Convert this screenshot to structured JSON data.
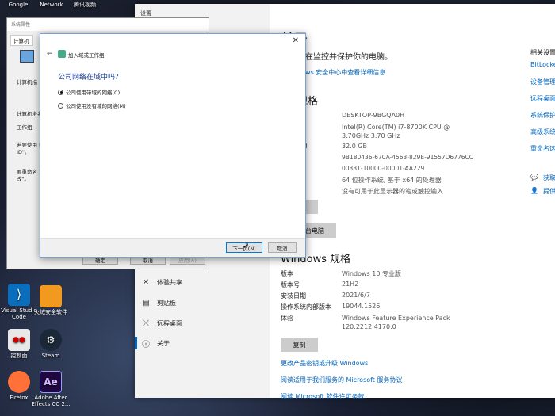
{
  "desktop": {
    "top_icons": [
      {
        "label": "Google"
      },
      {
        "label": "Network"
      },
      {
        "label": "腾讯视频"
      }
    ],
    "icons": [
      {
        "label": "Visual Studio Code",
        "icon": "vscode-icon",
        "color": "#0a6ebd"
      },
      {
        "label": "火绒安全软件",
        "icon": "huorong-icon",
        "color": "#f29a1f"
      },
      {
        "label": "控制面",
        "icon": "control-icon",
        "color": "#e8e8e8"
      },
      {
        "label": "Steam",
        "icon": "steam-icon",
        "color": "#1b2838"
      },
      {
        "label": "Firefox",
        "icon": "firefox-icon",
        "color": "#ff7139"
      },
      {
        "label": "Adobe After Effects CC 2...",
        "icon": "ae-icon",
        "color": "#1f0740",
        "badge": "Ae"
      }
    ]
  },
  "settings": {
    "window_title": "设置",
    "nav": [
      {
        "label": "体验共享",
        "icon": "share-icon"
      },
      {
        "label": "剪贴板",
        "icon": "clipboard-icon"
      },
      {
        "label": "远程桌面",
        "icon": "remote-icon"
      },
      {
        "label": "关于",
        "icon": "info-icon"
      }
    ],
    "page_title": "关于",
    "protect_text": "正在监控并保护你的电脑。",
    "security_link": "ndows 安全中心中查看详细信息",
    "device_spec_title": "规格",
    "device_specs": [
      {
        "label": "称",
        "value": "DESKTOP-9BGQA0H"
      },
      {
        "label": "",
        "value": "Intel(R) Core(TM) i7-8700K CPU @ 3.70GHz 3.70 GHz"
      },
      {
        "label": "AM",
        "value": "32.0 GB"
      },
      {
        "label": "",
        "value": "9B180436-670A-4563-829E-91557D6776CC"
      },
      {
        "label": "",
        "value": "00331-10000-00001-AA229"
      },
      {
        "label": "型",
        "value": "64 位操作系统, 基于 x64 的处理器"
      },
      {
        "label": "控",
        "value": "没有可用于此显示器的笔或触控输入"
      }
    ],
    "copy_btn_1": "制",
    "rename_btn": "名这台电脑",
    "win_spec_title": "Windows 规格",
    "win_specs": [
      {
        "label": "版本",
        "value": "Windows 10 专业版"
      },
      {
        "label": "版本号",
        "value": "21H2"
      },
      {
        "label": "安装日期",
        "value": "2021/6/7"
      },
      {
        "label": "操作系统内部版本",
        "value": "19044.1526"
      },
      {
        "label": "体验",
        "value": "Windows Feature Experience Pack 120.2212.4170.0"
      }
    ],
    "copy_btn_2": "复制",
    "links": [
      "更改产品密钥或升级 Windows",
      "阅读适用于我们服务的 Microsoft 服务协议",
      "阅读 Microsoft 软件许可条款"
    ],
    "related_title": "相关设置",
    "related_links": [
      "BitLocker",
      "设备管理",
      "远程桌面",
      "系统保护",
      "高级系统",
      "重命名这"
    ],
    "help": [
      {
        "label": "获取",
        "icon": "help-icon"
      },
      {
        "label": "提供",
        "icon": "feedback-icon"
      }
    ]
  },
  "sysprops": {
    "title": "系统属性",
    "tab": "计算机",
    "lines": [
      "计算机描述",
      "计算机全名:",
      "工作组:",
      "若要使用向导将计算机加入域或工作组,请单击\"网络 ID\"。",
      "要重命名这台计算机或者更改其域或工作组,请单击\"更改\"。"
    ],
    "short_lines": [
      "计算机描",
      "计算机全名",
      "工作组:",
      "若要使用 络 ID\"。",
      "要重命名 更改\"。"
    ],
    "ok": "确定",
    "cancel": "取消",
    "apply": "应用(A)"
  },
  "wizard": {
    "title": "加入域或工作组",
    "question": "公司网络在域中吗？",
    "options": [
      {
        "label": "公司使用带域的网络(C)",
        "selected": true
      },
      {
        "label": "公司使用没有域的网络(M)",
        "selected": false
      }
    ],
    "next": "下一页(N)",
    "cancel": "取消"
  }
}
